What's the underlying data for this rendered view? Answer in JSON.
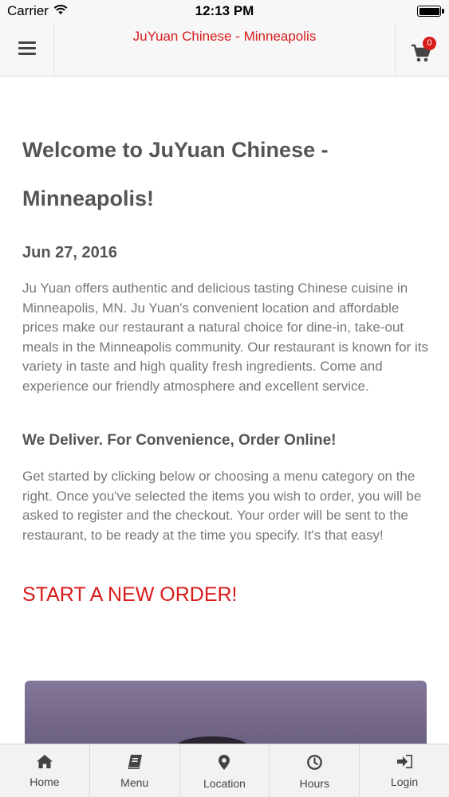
{
  "status_bar": {
    "carrier": "Carrier",
    "time": "12:13 PM",
    "wifi_icon": "wifi-icon",
    "battery_icon": "battery-icon"
  },
  "nav": {
    "title": "JuYuan Chinese - Minneapolis",
    "menu_icon": "hamburger-icon",
    "cart_icon": "cart-icon",
    "cart_count": "0"
  },
  "content": {
    "welcome_title": "Welcome to JuYuan Chinese - Minneapolis!",
    "date": "Jun 27, 2016",
    "intro_paragraph": "Ju Yuan offers authentic and delicious tasting Chinese cuisine in Minneapolis, MN. Ju Yuan's convenient location and affordable prices make our restaurant a natural choice for dine-in, take-out meals in the Minneapolis community. Our restaurant is known for its variety in taste and high quality fresh ingredients. Come and experience our friendly atmosphere and excellent service.",
    "delivery_heading": "We Deliver. For Convenience, Order Online!",
    "instructions_paragraph": "Get started by clicking below or choosing a menu category on the right. Once you've selected the items you wish to order, you will be asked to register and the checkout. Your order will be sent to the restaurant, to be ready at the time you specify. It's that easy!",
    "start_order_link": "START A NEW ORDER!"
  },
  "tab_bar": {
    "tabs": [
      {
        "label": "Home",
        "icon": "home-icon"
      },
      {
        "label": "Menu",
        "icon": "book-icon"
      },
      {
        "label": "Location",
        "icon": "map-pin-icon"
      },
      {
        "label": "Hours",
        "icon": "clock-icon"
      },
      {
        "label": "Login",
        "icon": "sign-in-icon"
      }
    ]
  },
  "colors": {
    "accent": "#d91b1b",
    "heading_text": "#555555",
    "body_text": "#777777",
    "bar_background": "#f7f7f7"
  }
}
